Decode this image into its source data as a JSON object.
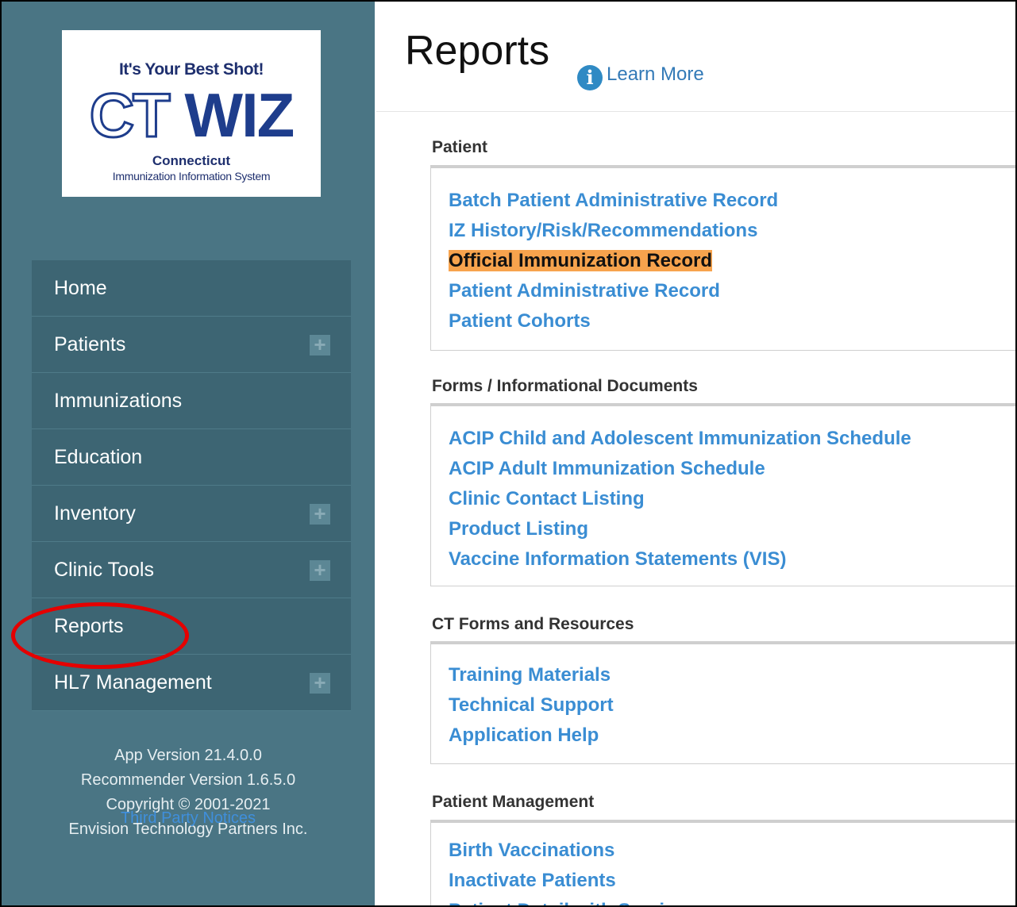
{
  "logo": {
    "tagline": "It's Your Best Shot!",
    "main_ct": "CT",
    "main_wiz": "WIZ",
    "subtitle": "Connecticut",
    "subtitle2": "Immunization Information System"
  },
  "nav": {
    "items": [
      {
        "label": "Home"
      },
      {
        "label": "Patients"
      },
      {
        "label": "Immunizations"
      },
      {
        "label": "Education"
      },
      {
        "label": "Inventory"
      },
      {
        "label": "Clinic Tools"
      },
      {
        "label": "Reports"
      },
      {
        "label": "HL7 Management"
      }
    ]
  },
  "footer": {
    "app_version": "App Version 21.4.0.0",
    "recommender_version": "Recommender Version 1.6.5.0",
    "copyright": "Copyright © 2001-2021",
    "company": "Envision Technology Partners Inc.",
    "third_party": "Third Party Notices"
  },
  "header": {
    "title": "Reports",
    "learn_more": "Learn More",
    "info_glyph": "i"
  },
  "sections": [
    {
      "title": "Patient",
      "links": [
        "Batch Patient Administrative Record",
        "IZ History/Risk/Recommendations",
        "Official Immunization Record",
        "Patient Administrative Record",
        "Patient Cohorts"
      ]
    },
    {
      "title": "Forms / Informational Documents",
      "links": [
        "ACIP Child and Adolescent Immunization Schedule",
        "ACIP Adult Immunization Schedule",
        "Clinic Contact Listing",
        "Product Listing",
        "Vaccine Information Statements (VIS)"
      ]
    },
    {
      "title": "CT Forms and Resources",
      "links": [
        "Training Materials",
        "Technical Support",
        "Application Help"
      ]
    },
    {
      "title": "Patient Management",
      "links": [
        "Birth Vaccinations",
        "Inactivate Patients",
        "Patient Detail with Services"
      ]
    }
  ],
  "colors": {
    "sidebar_bg": "#4a7584",
    "nav_bg": "#3d6573",
    "link": "#3a8dd3",
    "highlight": "#f7a34d",
    "annotation_circle": "#e50000"
  }
}
